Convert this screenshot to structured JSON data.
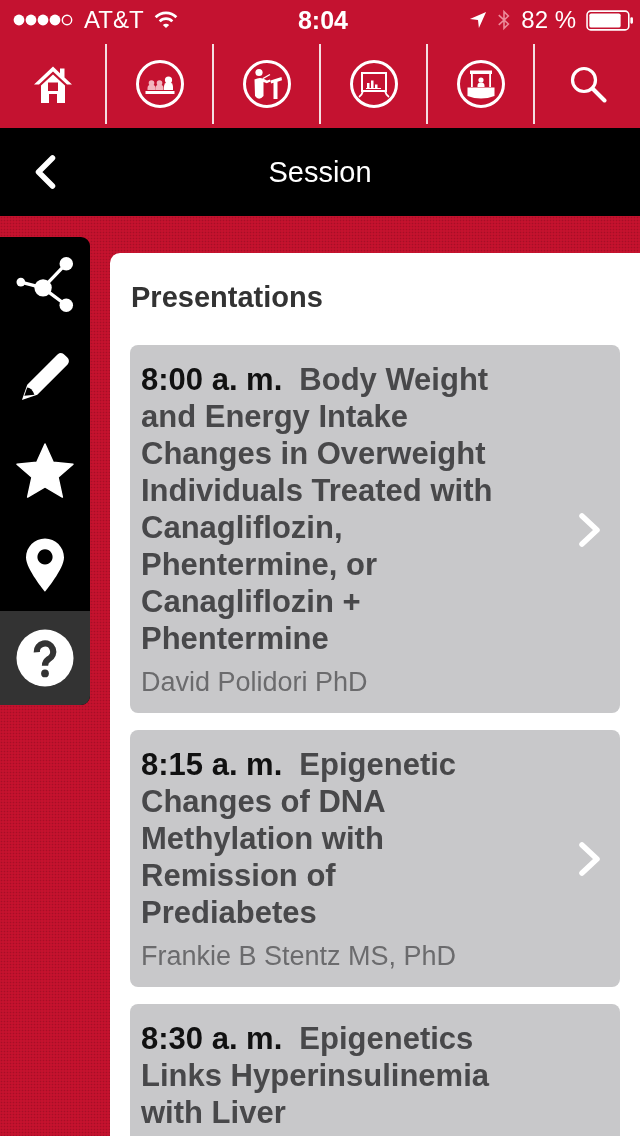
{
  "status_bar": {
    "carrier": "AT&T",
    "time": "8:04",
    "battery": "82 %"
  },
  "toolbar": {
    "items": [
      {
        "kind": "home"
      },
      {
        "kind": "audience"
      },
      {
        "kind": "speaker"
      },
      {
        "kind": "poster"
      },
      {
        "kind": "booth"
      },
      {
        "kind": "search"
      }
    ]
  },
  "header": {
    "title": "Session"
  },
  "sidebar": {
    "items": [
      {
        "kind": "share"
      },
      {
        "kind": "note"
      },
      {
        "kind": "favorite"
      },
      {
        "kind": "map"
      },
      {
        "kind": "help"
      }
    ]
  },
  "panel": {
    "heading": "Presentations",
    "presentations": [
      {
        "time": "8:00 a. m.",
        "title": "Body Weight and Energy Intake Changes in Overweight Individuals Treated with Canagliflozin, Phentermine, or Canagliflozin + Phentermine",
        "author": "David Polidori PhD",
        "show_arrow": true
      },
      {
        "time": "8:15 a. m.",
        "title": "Epigenetic Changes of DNA Methylation with Remission of Prediabetes",
        "author": "Frankie B Stentz MS, PhD",
        "show_arrow": true
      },
      {
        "time": "8:30 a. m.",
        "title": "Epigenetics Links Hyperinsulinemia with Liver",
        "show_arrow": false
      }
    ]
  }
}
